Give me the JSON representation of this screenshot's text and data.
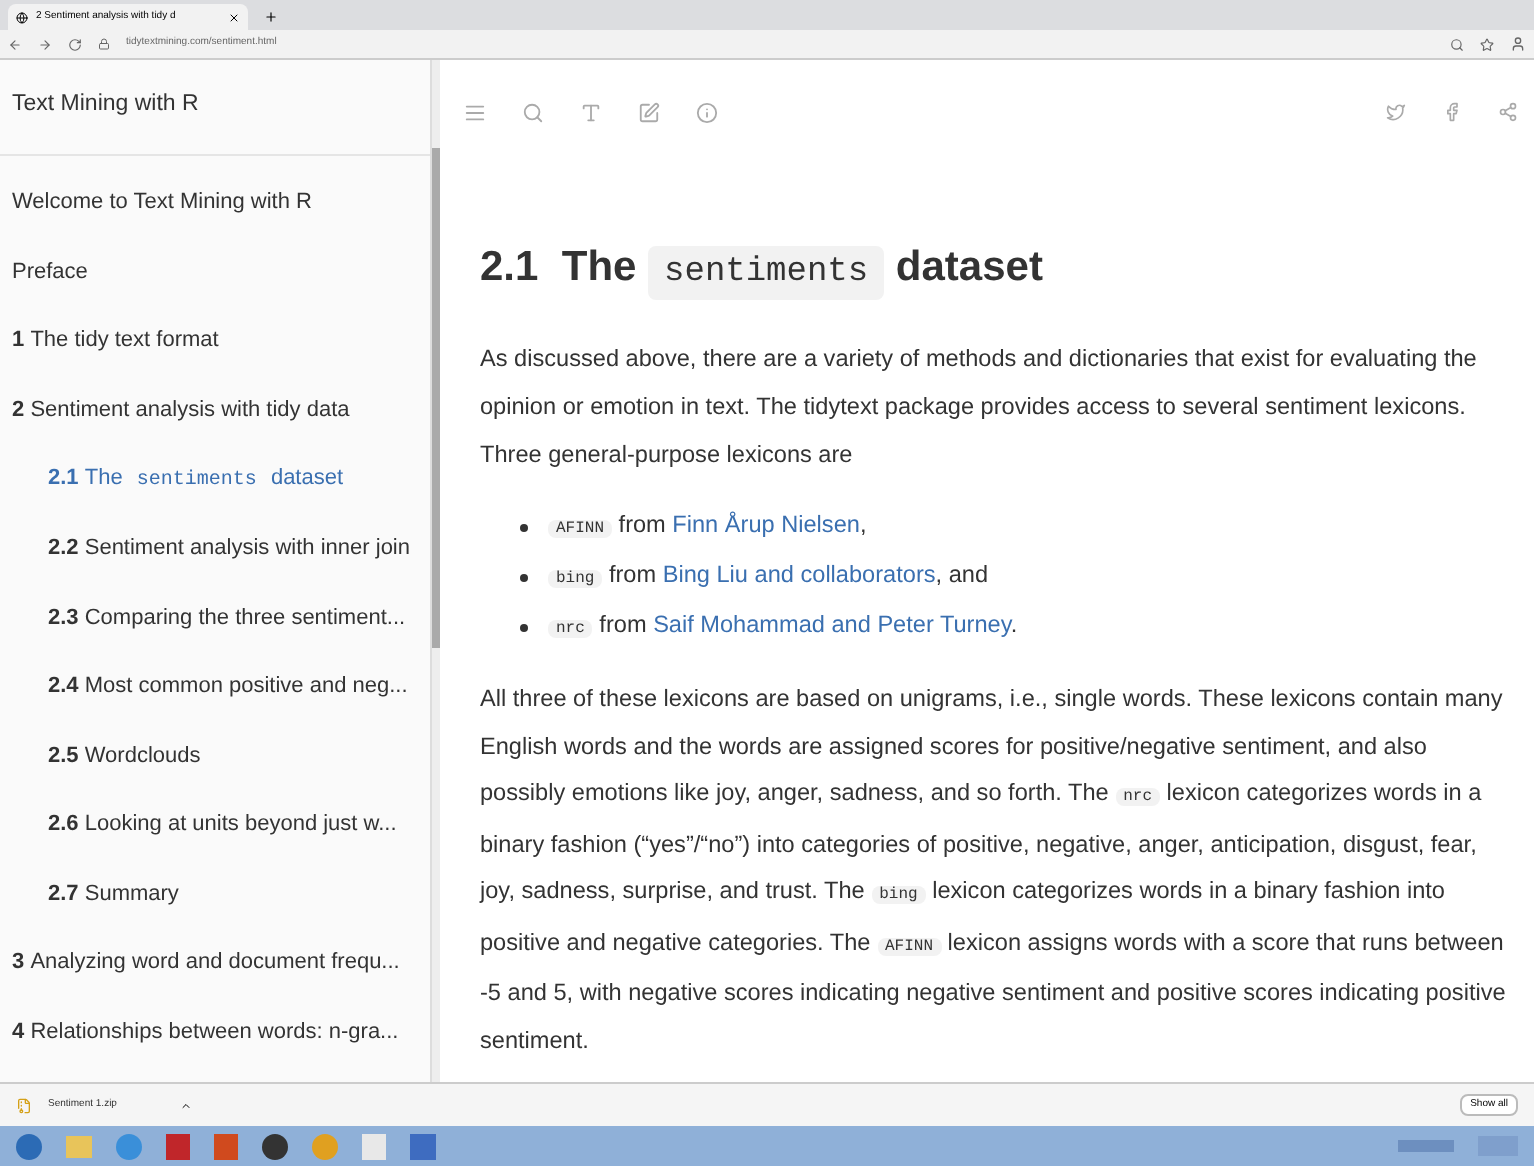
{
  "browser": {
    "tabs": [
      {
        "label": "2 Sentiment analysis with tidy d",
        "selected": true
      }
    ],
    "url": "tidytextmining.com/sentiment.html"
  },
  "sidebar": {
    "title": "Text Mining with R",
    "items": [
      {
        "parts": [
          {
            "kind": "text",
            "text": "Welcome to Text Mining with R"
          }
        ],
        "selected": false
      },
      {
        "parts": [
          {
            "kind": "text",
            "text": "Preface"
          }
        ],
        "selected": false
      },
      {
        "number": "1",
        "parts": [
          {
            "kind": "text",
            "text": "The tidy text format"
          }
        ],
        "selected": false
      },
      {
        "number": "2",
        "parts": [
          {
            "kind": "text",
            "text": "Sentiment analysis with tidy data"
          }
        ],
        "selected": false,
        "children": [
          {
            "number": "2.1",
            "parts": [
              {
                "kind": "text",
                "text": "The "
              },
              {
                "kind": "code",
                "text": "sentiments"
              },
              {
                "kind": "text",
                "text": " dataset"
              }
            ],
            "selected": true
          },
          {
            "number": "2.2",
            "parts": [
              {
                "kind": "text",
                "text": "Sentiment analysis with inner join"
              }
            ],
            "selected": false
          },
          {
            "number": "2.3",
            "parts": [
              {
                "kind": "text",
                "text": "Comparing the three sentiment..."
              }
            ],
            "selected": false
          },
          {
            "number": "2.4",
            "parts": [
              {
                "kind": "text",
                "text": "Most common positive and neg..."
              }
            ],
            "selected": false
          },
          {
            "number": "2.5",
            "parts": [
              {
                "kind": "text",
                "text": "Wordclouds"
              }
            ],
            "selected": false
          },
          {
            "number": "2.6",
            "parts": [
              {
                "kind": "text",
                "text": "Looking at units beyond just w..."
              }
            ],
            "selected": false
          },
          {
            "number": "2.7",
            "parts": [
              {
                "kind": "text",
                "text": "Summary"
              }
            ],
            "selected": false
          }
        ]
      },
      {
        "number": "3",
        "parts": [
          {
            "kind": "text",
            "text": "Analyzing word and document frequ..."
          }
        ],
        "selected": false
      },
      {
        "number": "4",
        "parts": [
          {
            "kind": "text",
            "text": "Relationships between words: n-gra..."
          }
        ],
        "selected": false
      }
    ]
  },
  "heading": {
    "number": "2.1",
    "parts": [
      {
        "kind": "text",
        "text": "The "
      },
      {
        "kind": "code",
        "text": "sentiments"
      },
      {
        "kind": "text",
        "text": " dataset"
      }
    ]
  },
  "intro": [
    {
      "kind": "text",
      "text": "As discussed above, there are a variety of methods and dictionaries that exist for evaluating the opinion or emotion in text. The tidytext package provides access to several sentiment lexicons. Three general-purpose lexicons are"
    }
  ],
  "lexicons": [
    [
      {
        "kind": "code",
        "text": "AFINN"
      },
      {
        "kind": "text",
        "text": " from "
      },
      {
        "kind": "link",
        "text": "Finn Årup Nielsen"
      },
      {
        "kind": "text",
        "text": ","
      }
    ],
    [
      {
        "kind": "code",
        "text": "bing"
      },
      {
        "kind": "text",
        "text": " from "
      },
      {
        "kind": "link",
        "text": "Bing Liu and collaborators"
      },
      {
        "kind": "text",
        "text": ", and"
      }
    ],
    [
      {
        "kind": "code",
        "text": "nrc"
      },
      {
        "kind": "text",
        "text": " from "
      },
      {
        "kind": "link",
        "text": "Saif Mohammad and Peter Turney"
      },
      {
        "kind": "text",
        "text": "."
      }
    ]
  ],
  "body": [
    {
      "kind": "text",
      "text": "All three of these lexicons are based on unigrams, i.e., single words. These lexicons contain many English words and the words are assigned scores for positive/negative sentiment, and also possibly emotions like joy, anger, sadness, and so forth. The "
    },
    {
      "kind": "code",
      "text": "nrc"
    },
    {
      "kind": "text",
      "text": " lexicon categorizes words in a binary fashion (“yes”/“no”) into categories of positive, negative, anger, anticipation, disgust, fear, joy, sadness, surprise, and trust. The "
    },
    {
      "kind": "code",
      "text": "bing"
    },
    {
      "kind": "text",
      "text": " lexicon categorizes words in a binary fashion into positive and negative categories. The "
    },
    {
      "kind": "code",
      "text": "AFINN"
    },
    {
      "kind": "text",
      "text": " lexicon assigns words with a score that runs between -5 and 5, with negative scores indicating negative sentiment and positive scores indicating positive sentiment."
    }
  ],
  "download_bar": {
    "file": "Sentiment 1.zip",
    "show_all": "Show all"
  }
}
